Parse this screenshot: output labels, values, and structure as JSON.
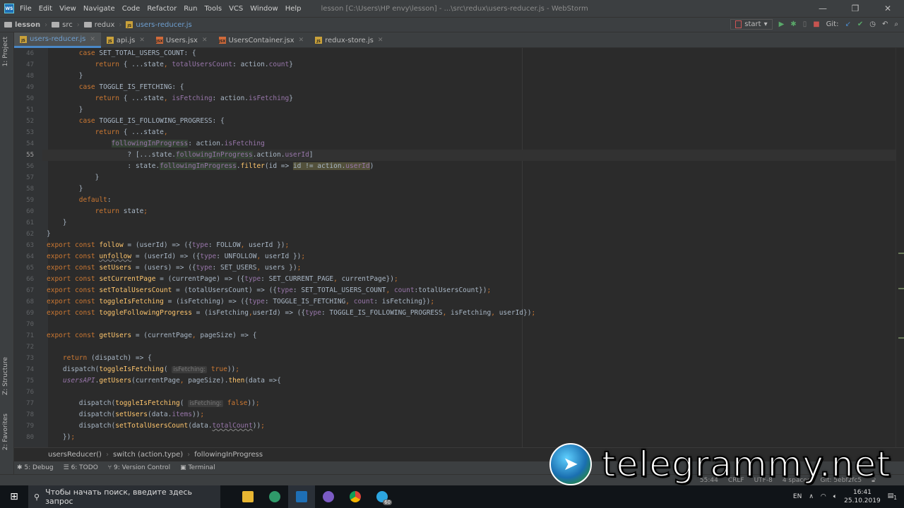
{
  "titlebar": {
    "menu": [
      "File",
      "Edit",
      "View",
      "Navigate",
      "Code",
      "Refactor",
      "Run",
      "Tools",
      "VCS",
      "Window",
      "Help"
    ],
    "title": "lesson [C:\\Users\\HP envy\\lesson] - ...\\src\\redux\\users-reducer.js - WebStorm"
  },
  "navbar": {
    "crumbs": [
      "lesson",
      "src",
      "redux",
      "users-reducer.js"
    ],
    "run_config": "start",
    "git_label": "Git:"
  },
  "tabs": [
    {
      "label": "users-reducer.js",
      "type": "js",
      "active": true
    },
    {
      "label": "api.js",
      "type": "js"
    },
    {
      "label": "Users.jsx",
      "type": "jsx"
    },
    {
      "label": "UsersContainer.jsx",
      "type": "jsx"
    },
    {
      "label": "redux-store.js",
      "type": "js"
    }
  ],
  "side_tools": {
    "project": "1: Project",
    "structure": "Z: Structure",
    "favorites": "2: Favorites"
  },
  "editor": {
    "current_line": 55,
    "lines": [
      {
        "n": 46,
        "t": [
          [
            "        "
          ],
          [
            "case",
            "k"
          ],
          [
            " SET_TOTAL_USERS_COUNT: {"
          ]
        ]
      },
      {
        "n": 47,
        "t": [
          [
            "            "
          ],
          [
            "return",
            "k"
          ],
          [
            " { ...state"
          ],
          [
            ", ",
            "k"
          ],
          [
            "totalUsersCount",
            "p"
          ],
          [
            ": action."
          ],
          [
            "count",
            "p"
          ],
          [
            "}"
          ]
        ]
      },
      {
        "n": 48,
        "t": [
          [
            "        }"
          ]
        ]
      },
      {
        "n": 49,
        "t": [
          [
            "        "
          ],
          [
            "case",
            "k"
          ],
          [
            " TOGGLE_IS_FETCHING: {"
          ]
        ]
      },
      {
        "n": 50,
        "t": [
          [
            "            "
          ],
          [
            "return",
            "k"
          ],
          [
            " { ...state"
          ],
          [
            ", ",
            "k"
          ],
          [
            "isFetching",
            "p"
          ],
          [
            ": action."
          ],
          [
            "isFetching",
            "p"
          ],
          [
            "}"
          ]
        ]
      },
      {
        "n": 51,
        "t": [
          [
            "        }"
          ]
        ]
      },
      {
        "n": 52,
        "t": [
          [
            "        "
          ],
          [
            "case",
            "k"
          ],
          [
            " TOGGLE_IS_FOLLOWING_PROGRESS: {"
          ]
        ]
      },
      {
        "n": 53,
        "t": [
          [
            "            "
          ],
          [
            "return",
            "k"
          ],
          [
            " { ...state"
          ],
          [
            ",",
            "k"
          ]
        ]
      },
      {
        "n": 54,
        "t": [
          [
            "                "
          ],
          [
            "followingInProgress",
            "p hl"
          ],
          [
            ": action."
          ],
          [
            "isFetching",
            "p"
          ]
        ]
      },
      {
        "n": 55,
        "t": [
          [
            "                    ? [...state."
          ],
          [
            "followingInProgress",
            "p hl"
          ],
          [
            ".action."
          ],
          [
            "userId",
            "p"
          ],
          [
            "]"
          ]
        ]
      },
      {
        "n": 56,
        "t": [
          [
            "                    : state."
          ],
          [
            "followingInProgress",
            "p hl"
          ],
          [
            "."
          ],
          [
            "filter",
            "f"
          ],
          [
            "(id => "
          ],
          [
            "id != action.",
            "hl2"
          ],
          [
            "userId",
            "p hl2"
          ],
          [
            ")"
          ]
        ]
      },
      {
        "n": 57,
        "t": [
          [
            "            }"
          ]
        ]
      },
      {
        "n": 58,
        "t": [
          [
            "        }"
          ]
        ]
      },
      {
        "n": 59,
        "t": [
          [
            "        "
          ],
          [
            "default",
            "k"
          ],
          [
            ":"
          ]
        ]
      },
      {
        "n": 60,
        "t": [
          [
            "            "
          ],
          [
            "return",
            "k"
          ],
          [
            " state"
          ],
          [
            ";",
            "k"
          ]
        ]
      },
      {
        "n": 61,
        "t": [
          [
            "    }"
          ]
        ]
      },
      {
        "n": 62,
        "t": [
          [
            "}"
          ]
        ]
      },
      {
        "n": 63,
        "t": [
          [
            "export const ",
            "k"
          ],
          [
            "follow",
            "f"
          ],
          [
            " = (userId) => ({"
          ],
          [
            "type",
            "p"
          ],
          [
            ": FOLLOW"
          ],
          [
            ", ",
            "k"
          ],
          [
            "userId })"
          ],
          [
            ";",
            "k"
          ]
        ]
      },
      {
        "n": 64,
        "t": [
          [
            "export const ",
            "k"
          ],
          [
            "unfollow",
            "f u"
          ],
          [
            " = (userId) => ({"
          ],
          [
            "type",
            "p"
          ],
          [
            ": UNFOLLOW"
          ],
          [
            ", ",
            "k"
          ],
          [
            "userId })"
          ],
          [
            ";",
            "k"
          ]
        ]
      },
      {
        "n": 65,
        "t": [
          [
            "export const ",
            "k"
          ],
          [
            "setUsers",
            "f"
          ],
          [
            " = (users) => ({"
          ],
          [
            "type",
            "p"
          ],
          [
            ": SET_USERS"
          ],
          [
            ", ",
            "k"
          ],
          [
            "users })"
          ],
          [
            ";",
            "k"
          ]
        ]
      },
      {
        "n": 66,
        "t": [
          [
            "export const ",
            "k"
          ],
          [
            "setCurrentPage",
            "f"
          ],
          [
            " = (currentPage) => ({"
          ],
          [
            "type",
            "p"
          ],
          [
            ": SET_CURRENT_PAGE"
          ],
          [
            ", ",
            "k"
          ],
          [
            "currentPage})"
          ],
          [
            ";",
            "k"
          ]
        ]
      },
      {
        "n": 67,
        "t": [
          [
            "export const ",
            "k"
          ],
          [
            "setTotalUsersCount",
            "f"
          ],
          [
            " = (totalUsersCount) => ({"
          ],
          [
            "type",
            "p"
          ],
          [
            ": SET_TOTAL_USERS_COUNT"
          ],
          [
            ", ",
            "k"
          ],
          [
            "count",
            "p"
          ],
          [
            ":totalUsersCount})"
          ],
          [
            ";",
            "k"
          ]
        ]
      },
      {
        "n": 68,
        "t": [
          [
            "export const ",
            "k"
          ],
          [
            "toggleIsFetching",
            "f"
          ],
          [
            " = (isFetching) => ({"
          ],
          [
            "type",
            "p"
          ],
          [
            ": TOGGLE_IS_FETCHING"
          ],
          [
            ", ",
            "k"
          ],
          [
            "count",
            "p"
          ],
          [
            ": isFetching})"
          ],
          [
            ";",
            "k"
          ]
        ]
      },
      {
        "n": 69,
        "t": [
          [
            "export const ",
            "k"
          ],
          [
            "toggleFollowingProgress",
            "f"
          ],
          [
            " = (isFetching"
          ],
          [
            ",",
            "k"
          ],
          [
            "userId) => ({"
          ],
          [
            "type",
            "p"
          ],
          [
            ": TOGGLE_IS_FOLLOWING_PROGRESS"
          ],
          [
            ", ",
            "k"
          ],
          [
            "isFetching"
          ],
          [
            ", ",
            "k"
          ],
          [
            "userId})"
          ],
          [
            ";",
            "k"
          ]
        ]
      },
      {
        "n": 70,
        "t": [
          [
            ""
          ]
        ]
      },
      {
        "n": 71,
        "t": [
          [
            "export const ",
            "k"
          ],
          [
            "getUsers",
            "f"
          ],
          [
            " = (currentPage"
          ],
          [
            ", ",
            "k"
          ],
          [
            "pageSize) => {"
          ]
        ]
      },
      {
        "n": 72,
        "t": [
          [
            ""
          ]
        ]
      },
      {
        "n": 73,
        "t": [
          [
            "    "
          ],
          [
            "return",
            "k"
          ],
          [
            " (dispatch) => {"
          ]
        ]
      },
      {
        "n": 74,
        "t": [
          [
            "    dispatch("
          ],
          [
            "toggleIsFetching",
            "f"
          ],
          [
            "( "
          ],
          [
            "isFetching:",
            "h"
          ],
          [
            " "
          ],
          [
            "true",
            "k"
          ],
          [
            "))"
          ],
          [
            ";",
            "k"
          ]
        ]
      },
      {
        "n": 75,
        "t": [
          [
            "    "
          ],
          [
            "usersAPI",
            "i"
          ],
          [
            "."
          ],
          [
            "getUsers",
            "f"
          ],
          [
            "(currentPage"
          ],
          [
            ", ",
            "k"
          ],
          [
            "pageSize)."
          ],
          [
            "then",
            "f"
          ],
          [
            "(data =>{"
          ]
        ]
      },
      {
        "n": 76,
        "t": [
          [
            ""
          ]
        ]
      },
      {
        "n": 77,
        "t": [
          [
            "        dispatch("
          ],
          [
            "toggleIsFetching",
            "f"
          ],
          [
            "( "
          ],
          [
            "isFetching:",
            "h"
          ],
          [
            " "
          ],
          [
            "false",
            "k"
          ],
          [
            "))"
          ],
          [
            ";",
            "k"
          ]
        ]
      },
      {
        "n": 78,
        "t": [
          [
            "        dispatch("
          ],
          [
            "setUsers",
            "f"
          ],
          [
            "(data."
          ],
          [
            "items",
            "p"
          ],
          [
            "))"
          ],
          [
            ";",
            "k"
          ]
        ]
      },
      {
        "n": 79,
        "t": [
          [
            "        dispatch("
          ],
          [
            "setTotalUsersCount",
            "f"
          ],
          [
            "(data."
          ],
          [
            "totalCount",
            "p u"
          ],
          [
            "))"
          ],
          [
            ";",
            "k"
          ]
        ]
      },
      {
        "n": 80,
        "t": [
          [
            "    })"
          ],
          [
            ";",
            "k"
          ]
        ]
      }
    ]
  },
  "breadcrumbs": [
    "usersReducer()",
    "switch (action.type)",
    "followingInProgress"
  ],
  "toolwindows": [
    "5: Debug",
    "6: TODO",
    "9: Version Control",
    "Terminal"
  ],
  "status": {
    "position": "55:44",
    "line_sep": "CRLF",
    "encoding": "UTF-8",
    "indent": "4 spaces",
    "git": "Git: 5ebf2fc5"
  },
  "taskbar": {
    "search_placeholder": "Чтобы начать поиск, введите здесь запрос",
    "lang": "EN",
    "time": "16:41",
    "date": "25.10.2019",
    "telegram_badge": "60",
    "notif": "1"
  },
  "watermark": "telegrammy.net"
}
